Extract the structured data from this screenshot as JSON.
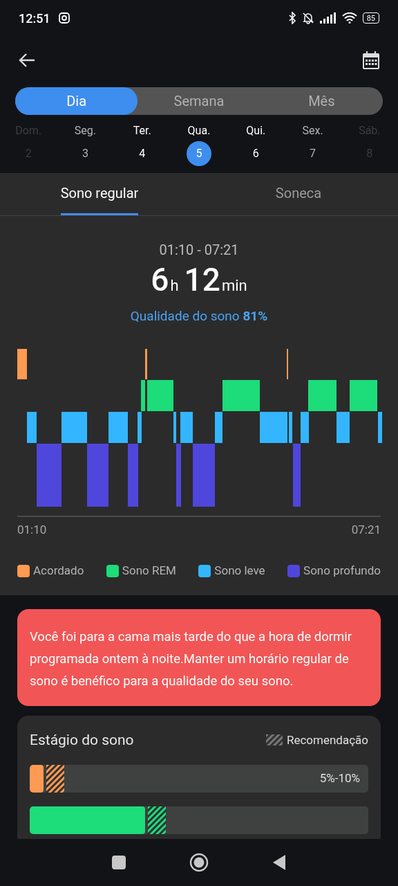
{
  "status_bar": {
    "time": "12:51",
    "battery": "85"
  },
  "period_tabs": [
    {
      "label": "Dia",
      "selected": true
    },
    {
      "label": "Semana",
      "selected": false
    },
    {
      "label": "Mês",
      "selected": false
    }
  ],
  "days": [
    {
      "weekday": "Dom.",
      "date": "2",
      "selected": false,
      "disabled": true
    },
    {
      "weekday": "Seg.",
      "date": "3",
      "selected": false,
      "disabled": false
    },
    {
      "weekday": "Ter.",
      "date": "4",
      "selected": false,
      "disabled": false
    },
    {
      "weekday": "Qua.",
      "date": "5",
      "selected": true,
      "disabled": false
    },
    {
      "weekday": "Qui.",
      "date": "6",
      "selected": false,
      "disabled": false
    },
    {
      "weekday": "Sex.",
      "date": "7",
      "selected": false,
      "disabled": false
    },
    {
      "weekday": "Sáb.",
      "date": "8",
      "selected": false,
      "disabled": true
    }
  ],
  "sleep_tabs": [
    {
      "label": "Sono regular",
      "selected": true
    },
    {
      "label": "Soneca",
      "selected": false
    }
  ],
  "summary": {
    "range": "01:10 - 07:21",
    "hours": "6",
    "hours_unit": "h",
    "minutes": "12",
    "minutes_unit": "min",
    "quality_label": "Qualidade do sono",
    "quality_value": "81%"
  },
  "hypnogram": {
    "start": "01:10",
    "end": "07:21"
  },
  "legend": [
    {
      "label": "Acordado",
      "color": "#ff9a52"
    },
    {
      "label": "Sono REM",
      "color": "#1ddc7a"
    },
    {
      "label": "Sono leve",
      "color": "#33b6ff"
    },
    {
      "label": "Sono profundo",
      "color": "#4f46dc"
    }
  ],
  "alert": {
    "text": "Você foi para a cama mais tarde do que a hora de dormir programada ontem à noite.Manter um horário regular de sono é benéfico para a qualidade do seu sono."
  },
  "stages": {
    "title": "Estágio do sono",
    "recommendation_label": "Recomendação",
    "rows": [
      {
        "level": 0.04,
        "color": "#ff9a52",
        "range": "5%-10%"
      },
      {
        "level": 0.34,
        "color": "#1ddc7a"
      }
    ]
  }
}
